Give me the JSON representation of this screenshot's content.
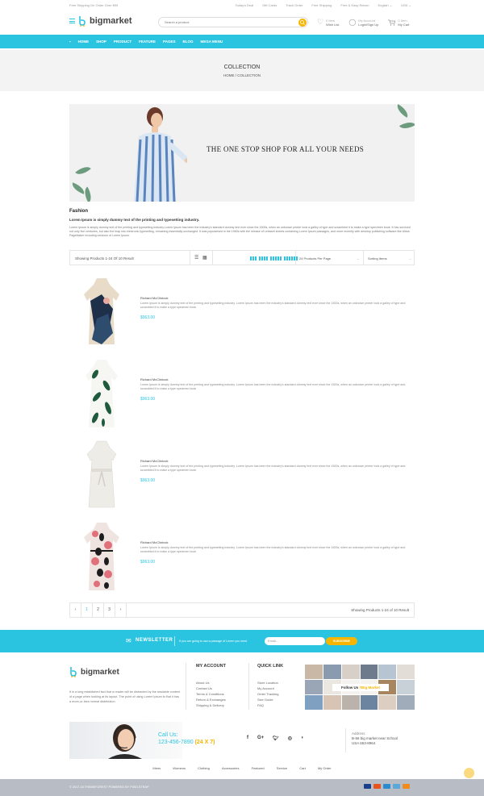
{
  "topbar": {
    "shipping_note": "Free Shipping On Order Over $99",
    "links": [
      "Today's Deal",
      "Gift Cards",
      "Track Order",
      "Free Shipping",
      "Free & Easy Return"
    ],
    "language": "English",
    "currency": "USD"
  },
  "header": {
    "logo_text": "bigmarket",
    "search_placeholder": "Search a product",
    "wishlist_count": "0 Item",
    "wishlist_label": "Wish List",
    "account_title": "My Account",
    "account_action": "Login/Sign Up",
    "cart_count": "0 Item",
    "cart_label": "My Cart"
  },
  "nav": [
    "HOME",
    "SHOP",
    "PRODUCT",
    "FEATURE",
    "PAGES",
    "BLOG",
    "MEGA MENU"
  ],
  "breadcrumb": {
    "title": "COLLECTION",
    "path": "HOME  /  COLLECTION"
  },
  "hero": {
    "tagline": "THE ONE STOP SHOP FOR ALL YOUR NEEDS"
  },
  "intro": {
    "heading": "Fashion",
    "subheading": "Lorem Ipsum is simply dummy text of the printing and typesetting industry.",
    "body": "Lorem Ipsum is simply dummy text of the printing and typesetting industry.Lorem Ipsum has been the industry's standard dummy text ever since the 1500s, when an unknown printer took a galley of type and scrambled it to make a type specimen book. It has survived not only five centuries, but also the leap into electronic typesetting, remaining essentially unchanged. It was popularised in the 1960s with the release of Letraset sheets containing Lorem Ipsum passages, and more recently with desktop publishing software like Aldus PageMaker including versions of Lorem Ipsum."
  },
  "toolbar": {
    "count": "Showing Products 1-24 Of 10 Result",
    "per_page": "24 Products Per Page",
    "sort": "Sorting Items"
  },
  "products": [
    {
      "name": "Richard McClintock",
      "desc": "Lorem Ipsum is simply dummy text of the printing and typesetting industry. Lorem Ipsum has been the industry's standard dummy text ever since the 1500s, when an unknown printer took a galley of type and scrambled it to make a type specimen book",
      "price": "$963.00"
    },
    {
      "name": "Richard McClintock",
      "desc": "Lorem Ipsum is simply dummy text of the printing and typesetting industry. Lorem Ipsum has been the industry's standard dummy text ever since the 1500s, when an unknown printer took a galley of type and scrambled it to make a type specimen book",
      "price": "$963.00"
    },
    {
      "name": "Richard McClintock",
      "desc": "Lorem Ipsum is simply dummy text of the printing and typesetting industry. Lorem Ipsum has been the industry's standard dummy text ever since the 1500s, when an unknown printer took a galley of type and scrambled it to make a type specimen book",
      "price": "$963.00"
    },
    {
      "name": "Richard McClintock",
      "desc": "Lorem Ipsum is simply dummy text of the printing and typesetting industry. Lorem Ipsum has been the industry's standard dummy text ever since the 1500s, when an unknown printer took a galley of type and scrambled it to make a type specimen book",
      "price": "$963.00"
    }
  ],
  "pagination": {
    "prev": "‹",
    "pages": [
      "1",
      "2",
      "3"
    ],
    "next": "›",
    "result": "Showing Products 1-24 of 10 Result"
  },
  "newsletter": {
    "title": "NEWSLETTER",
    "message": "If you are going to use a passage of Lorem you need",
    "email_placeholder": "Email...",
    "subscribe": "SUBSCRIBE"
  },
  "footer": {
    "about": "It is a long established fact that a reader will be distracted by the readable content of a page when looking at its layout. The point of using Lorem Ipsum is that it has a more-or-less normal distribution",
    "my_account_title": "MY ACCOUNT",
    "my_account_links": [
      "About Us",
      "Contact Us",
      "Terms & Conditions",
      "Return & Exchanges",
      "Shipping & Delivery"
    ],
    "quick_link_title": "QUICK LINK",
    "quick_links": [
      "Store Location",
      "My Account",
      "Order Tracking",
      "Size Guide",
      "FAQ"
    ],
    "follow_prefix": "Follow Us",
    "follow_handle": "#Big Market",
    "call_label": "Call Us:",
    "phone": "123-456-7890",
    "phone_hours": "(24 X 7)",
    "social_icons": [
      "facebook-icon",
      "google-plus-icon",
      "twitter-icon",
      "instagram-icon",
      "rss-icon"
    ],
    "address_label": "Address",
    "address_line1": "B-56 big market near School",
    "address_line2": "USA 653-8964",
    "nav": [
      "Mens",
      "Womens",
      "Clothing",
      "Accessories",
      "Featured",
      "Service",
      "Cart",
      "My Order"
    ],
    "copyright": "© 2017-18 THEMEFOREST POWERED BY PIXELSTRAP"
  },
  "colors": {
    "accent": "#2bc4e0",
    "highlight": "#f7b500",
    "footer_bar": "#b8bcc4"
  }
}
